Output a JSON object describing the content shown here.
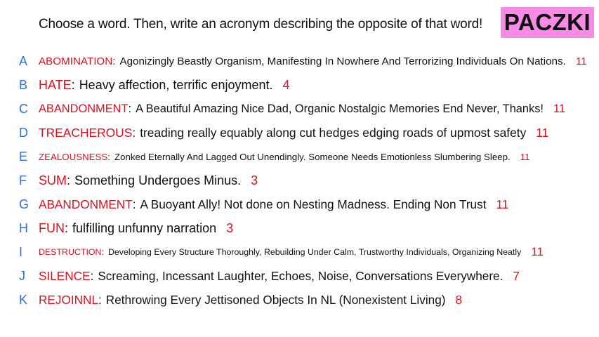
{
  "header": {
    "prompt": "Choose a word. Then, write an acronym describing the opposite of that word!",
    "brand": "PACZKI"
  },
  "colors": {
    "letter": "#2f6fe8",
    "word": "#dd1020",
    "count": "#dd1020",
    "brand_background": "#f78be6"
  },
  "answers": [
    {
      "letter": "A",
      "word": "ABOMINATION",
      "acronym": "Agonizingly Beastly Organism, Manifesting In Nowhere And Terrorizing Individuals On Nations.",
      "count": "11"
    },
    {
      "letter": "B",
      "word": "HATE",
      "acronym": "Heavy affection, terrific enjoyment.",
      "count": "4"
    },
    {
      "letter": "C",
      "word": "ABANDONMENT",
      "acronym": "A Beautiful Amazing Nice Dad, Organic Nostalgic Memories End Never, Thanks!",
      "count": "11"
    },
    {
      "letter": "D",
      "word": "TREACHEROUS",
      "acronym": "treading really equably along cut hedges edging roads of upmost safety",
      "count": "11"
    },
    {
      "letter": "E",
      "word": "ZEALOUSNESS",
      "acronym": "Zonked Eternally And Lagged Out Unendingly. Someone Needs Emotionless Slumbering Sleep.",
      "count": "11"
    },
    {
      "letter": "F",
      "word": "SUM",
      "acronym": "Something Undergoes Minus.",
      "count": "3"
    },
    {
      "letter": "G",
      "word": "ABANDONMENT",
      "acronym": "A Buoyant Ally! Not done on Nesting Madness. Ending Non Trust",
      "count": "11"
    },
    {
      "letter": "H",
      "word": "FUN",
      "acronym": "fulfilling unfunny narration",
      "count": "3"
    },
    {
      "letter": "I",
      "word": "DESTRUCTION",
      "acronym": "Developing Every Structure Thoroughly, Rebuilding Under Calm, Trustworthy Individuals, Organizing Neatly",
      "count": "11"
    },
    {
      "letter": "J",
      "word": "SILENCE",
      "acronym": "Screaming, Incessant Laughter, Echoes, Noise, Conversations Everywhere.",
      "count": "7"
    },
    {
      "letter": "K",
      "word": "REJOINNL",
      "acronym": "Rethrowing Every Jettisoned Objects In NL (Nonexistent Living)",
      "count": "8"
    }
  ]
}
